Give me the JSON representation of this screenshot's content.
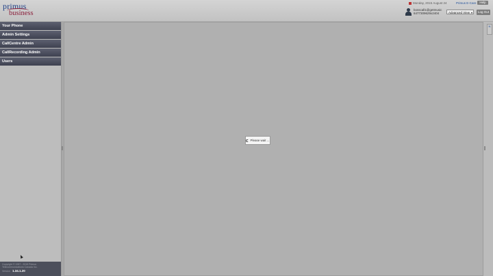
{
  "header": {
    "logo_primary": "primus",
    "logo_secondary": "business",
    "date": "Monday, 2015 August 24",
    "brand_link": "Primus E-Care",
    "help_label": "Help",
    "user_email": "bosscall1@getmusic",
    "user_number": "6477309629x2404",
    "view_select": "Advanced View",
    "logout_label": "Log Out"
  },
  "sidebar": {
    "items": [
      {
        "label": "Your Phone"
      },
      {
        "label": "Admin Settings"
      },
      {
        "label": "CallCentre Admin"
      },
      {
        "label": "CallRecording Admin"
      },
      {
        "label": "Users"
      }
    ],
    "footer": {
      "copyright_line1": "Copyright © 1997 - 2015 Primus",
      "copyright_line2": "Telecommunications Canada Inc.",
      "version_label": "Version",
      "version_value": "1.34.1.20"
    }
  },
  "right_rail": {
    "tab_label": "N"
  },
  "loading": {
    "message": "Please wait ..."
  },
  "colors": {
    "brand_blue": "#1f3f86",
    "brand_red": "#8a1e3a",
    "nav_bg": "#4a4d5c",
    "content_bg": "#b0b0b0"
  }
}
